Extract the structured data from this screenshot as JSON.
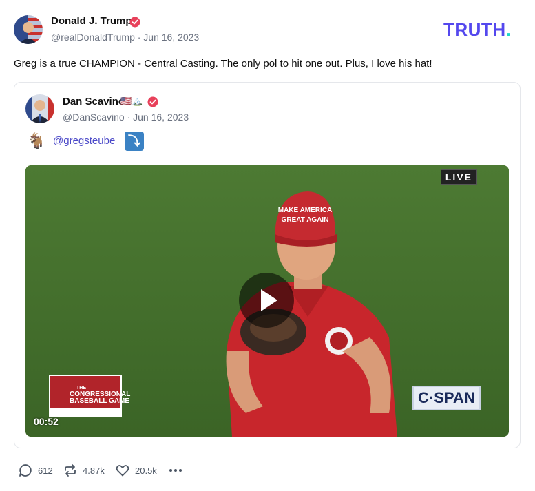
{
  "post": {
    "author_name": "Donald J. Trump",
    "author_handle": "@realDonaldTrump",
    "date": "Jun 16, 2023",
    "handle_line": "@realDonaldTrump · Jun 16, 2023",
    "text": "Greg is a true CHAMPION - Central Casting. The only pol to hit one out. Plus, I love his hat!",
    "verified_icon": "verified-badge-icon"
  },
  "brand": {
    "logo_text": "TRUTH",
    "logo_dot": ".",
    "accent": "#5448ee",
    "dot_color": "#1ed8c8"
  },
  "quote": {
    "author_name": "Dan Scavino",
    "name_emoji": "🇺🇸🏔️",
    "author_handle": "@DanScavino",
    "date": "Jun 16, 2023",
    "handle_line": "@DanScavino · Jun 16, 2023",
    "goat_emoji": "🐐",
    "mention": "@gregsteube",
    "arrow_emoji": "⤵"
  },
  "video": {
    "live_label": "LIVE",
    "network_logo": "C·SPAN",
    "game_logo_line1": "THE",
    "game_logo_line2": "CONGRESSIONAL",
    "game_logo_line3": "BASEBALL GAME",
    "hat_text_line1": "MAKE AMERICA",
    "hat_text_line2": "GREAT AGAIN",
    "duration": "00:52",
    "play_icon": "play-icon"
  },
  "actions": {
    "replies": "612",
    "reposts": "4.87k",
    "likes": "20.5k",
    "more_icon": "more-dots-icon"
  }
}
